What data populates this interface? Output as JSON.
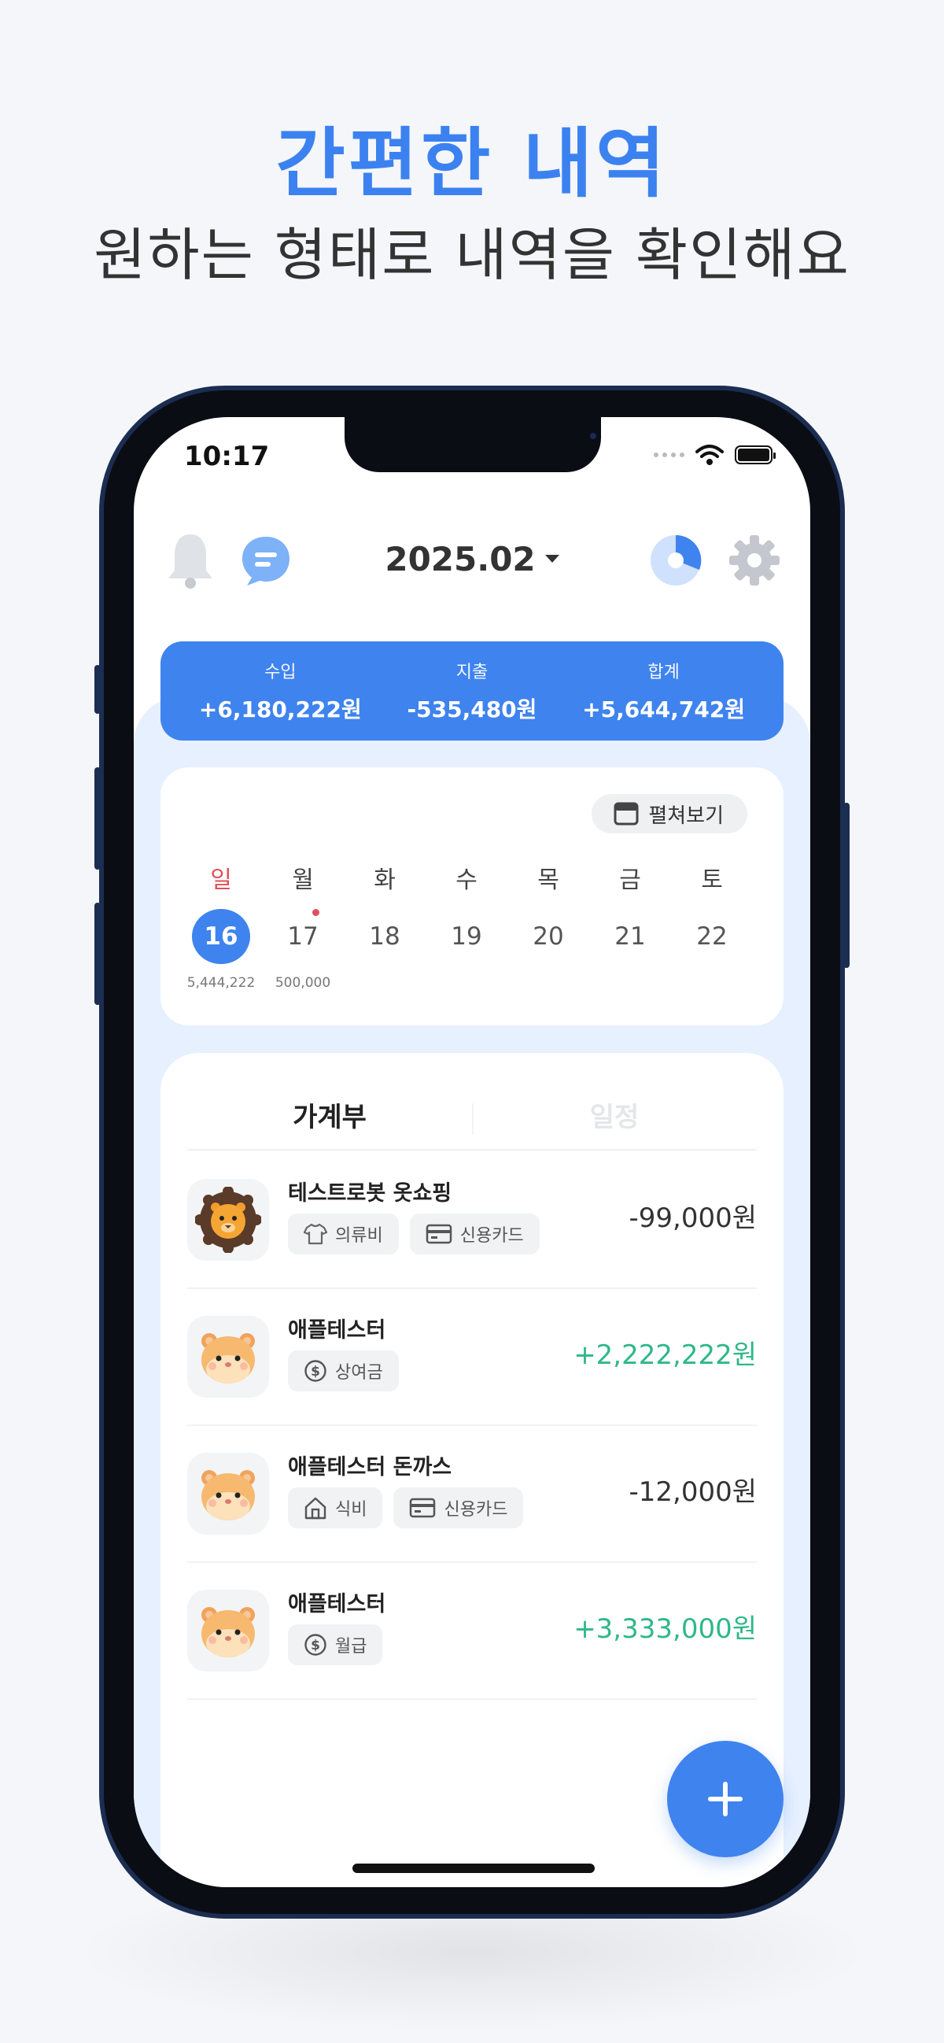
{
  "hero": {
    "title": "간편한 내역",
    "subtitle": "원하는 형태로 내역을 확인해요"
  },
  "status_bar": {
    "time": "10:17",
    "icons": [
      "signal-dots-icon",
      "wifi-icon",
      "battery-icon"
    ]
  },
  "header": {
    "month": "2025.02",
    "left_icons": [
      "bell-icon",
      "chat-icon"
    ],
    "right_icons": [
      "pie-chart-icon",
      "gear-icon"
    ]
  },
  "summary": {
    "income_label": "수입",
    "income_value": "+6,180,222원",
    "expense_label": "지출",
    "expense_value": "-535,480원",
    "total_label": "합계",
    "total_value": "+5,644,742원"
  },
  "calendar": {
    "expand_label": "펼쳐보기",
    "weekdays": [
      "일",
      "월",
      "화",
      "수",
      "목",
      "금",
      "토"
    ],
    "dates": [
      "16",
      "17",
      "18",
      "19",
      "20",
      "21",
      "22"
    ],
    "selected_date": "16",
    "amounts": [
      "5,444,222",
      "500,000",
      "",
      "",
      "",
      "",
      ""
    ]
  },
  "tabs": {
    "ledger": "가계부",
    "schedule": "일정"
  },
  "transactions": [
    {
      "title": "테스트로봇 옷쇼핑",
      "avatar": "lion-avatar",
      "tags": [
        {
          "icon": "shirt-icon",
          "label": "의류비"
        },
        {
          "icon": "credit-card-icon",
          "label": "신용카드"
        }
      ],
      "amount": "-99,000원",
      "positive": false
    },
    {
      "title": "애플테스터",
      "avatar": "hamster-avatar",
      "tags": [
        {
          "icon": "dollar-icon",
          "label": "상여금"
        }
      ],
      "amount": "+2,222,222원",
      "positive": true
    },
    {
      "title": "애플테스터 돈까스",
      "avatar": "hamster-avatar",
      "tags": [
        {
          "icon": "house-icon",
          "label": "식비"
        },
        {
          "icon": "credit-card-icon",
          "label": "신용카드"
        }
      ],
      "amount": "-12,000원",
      "positive": false
    },
    {
      "title": "애플테스터",
      "avatar": "hamster-avatar",
      "tags": [
        {
          "icon": "dollar-icon",
          "label": "월급"
        }
      ],
      "amount": "+3,333,000원",
      "positive": true
    }
  ],
  "colors": {
    "accent": "#3f83ee",
    "hero_title": "#3b82f0",
    "positive": "#2fb889",
    "sunday": "#e0505a"
  }
}
